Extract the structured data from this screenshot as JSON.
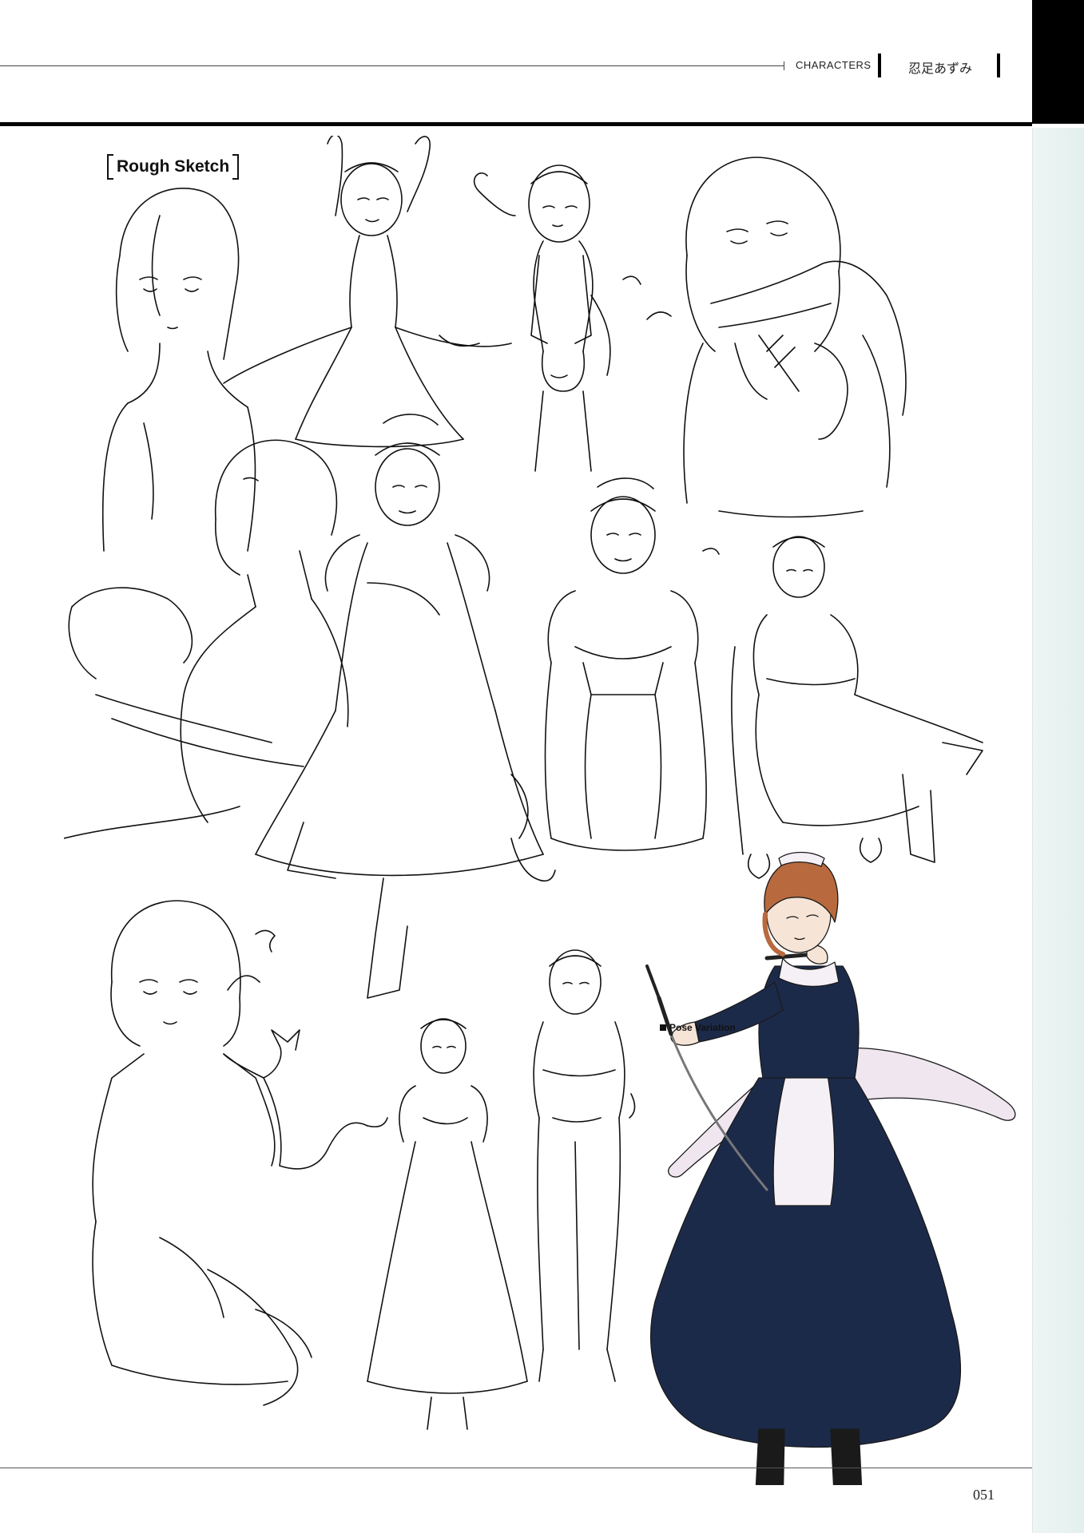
{
  "header": {
    "section": "CHARACTERS",
    "character_name": "忍足あずみ"
  },
  "section_label": "Rough Sketch",
  "pose_caption": "Pose Variation",
  "footer": {
    "page_number": "051"
  },
  "colors": {
    "ink": "#111111",
    "accent_tab": "#000000",
    "side_tint": "#e6f1f0",
    "dress_navy": "#1c2a4a",
    "apron_tint": "#efe6ef",
    "hair_brown": "#b86a3e",
    "skin": "#f6e4d6"
  },
  "illustrations": [
    {
      "name": "bust-sketch-portrait",
      "icon": "sketch-portrait-icon"
    },
    {
      "name": "maid-arms-raised-sketch",
      "icon": "sketch-figure-icon"
    },
    {
      "name": "towel-standing-sketch",
      "icon": "sketch-figure-icon"
    },
    {
      "name": "scarf-closeup-sketch",
      "icon": "sketch-portrait-icon"
    },
    {
      "name": "seated-back-sketch",
      "icon": "sketch-figure-icon"
    },
    {
      "name": "maid-seated-stool-sketch",
      "icon": "sketch-figure-icon"
    },
    {
      "name": "maid-arms-crossed-sketch",
      "icon": "sketch-figure-icon"
    },
    {
      "name": "maid-chair-sketch",
      "icon": "sketch-figure-icon"
    },
    {
      "name": "cat-holding-sketch",
      "icon": "sketch-figure-icon"
    },
    {
      "name": "maid-standing-small-sketch",
      "icon": "sketch-figure-icon"
    },
    {
      "name": "casual-standing-sketch",
      "icon": "sketch-figure-icon"
    },
    {
      "name": "maid-katana-color-illustration",
      "icon": "color-illustration-icon"
    }
  ]
}
